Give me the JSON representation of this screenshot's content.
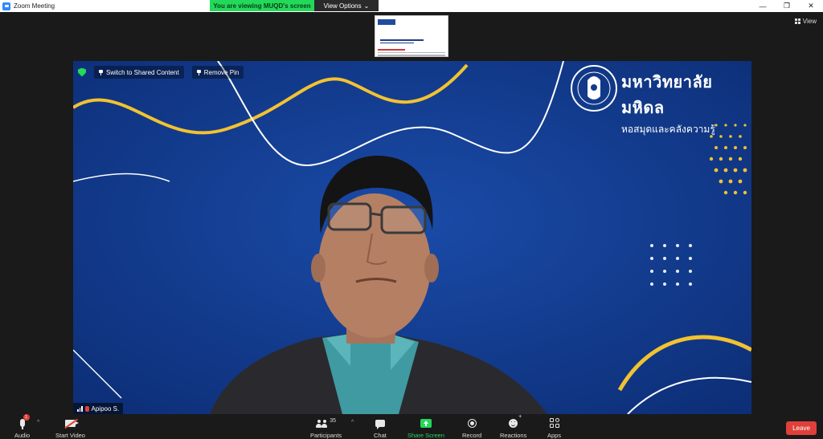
{
  "window": {
    "title": "Zoom Meeting",
    "minimize": "—",
    "maximize": "❐",
    "close": "✕"
  },
  "banner": {
    "viewing": "You are viewing MUQD's screen",
    "view_options": "View Options",
    "view_options_caret": "⌄"
  },
  "view_button": {
    "label": "View"
  },
  "video": {
    "overlay": {
      "switch_label": "Switch to Shared Content",
      "remove_pin_label": "Remove Pin"
    },
    "university_title": "มหาวิทยาลัยมหิดล",
    "university_subtitle": "หอสมุดและคลังความรู้",
    "participant_name": "Apipoo S."
  },
  "toolbar": {
    "audio": {
      "label": "Audio",
      "badge": "1"
    },
    "video": {
      "label": "Start Video"
    },
    "participants": {
      "label": "Participants",
      "count": "35"
    },
    "chat": {
      "label": "Chat"
    },
    "share": {
      "label": "Share Screen"
    },
    "record": {
      "label": "Record"
    },
    "reactions": {
      "label": "Reactions",
      "plus": "+"
    },
    "apps": {
      "label": "Apps"
    },
    "leave": {
      "label": "Leave"
    },
    "caret": "^"
  },
  "colors": {
    "accent_green": "#23d959",
    "leave_red": "#e0403a",
    "video_bg": "#123b8d",
    "toolbar_bg": "#1a1a1a"
  }
}
